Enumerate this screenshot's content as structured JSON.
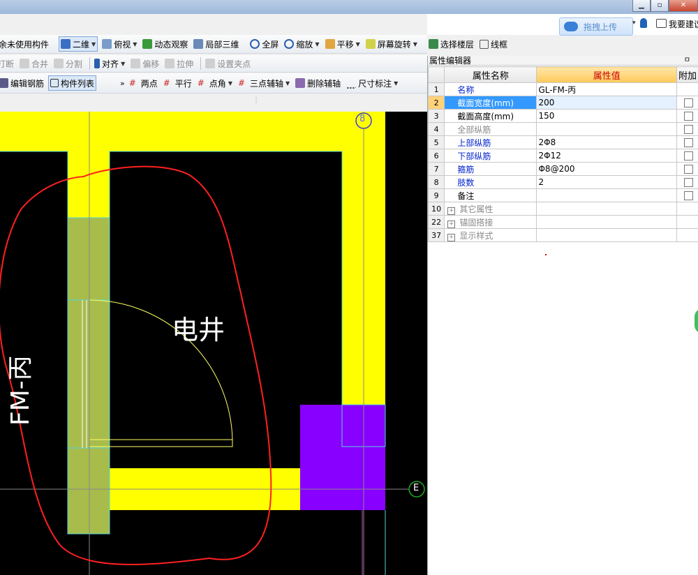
{
  "topbar": {
    "upload_label": "拖拽上传",
    "suggest_label": "我要建议",
    "min": "▁",
    "max": "▫",
    "close": "✕"
  },
  "toolbar1": {
    "items": [
      "余未使用构件",
      "二维",
      "俯视",
      "动态观察",
      "局部三维",
      "全屏",
      "缩放",
      "平移",
      "屏幕旋转",
      "选择楼层",
      "线框"
    ]
  },
  "toolbar2": {
    "items": [
      "打断",
      "合并",
      "分割",
      "对齐",
      "偏移",
      "拉伸",
      "设置夹点"
    ]
  },
  "toolbar3": {
    "items": [
      "编辑钢筋",
      "构件列表",
      "两点",
      "平行",
      "点角",
      "三点辅轴",
      "删除辅轴",
      "尺寸标注"
    ]
  },
  "canvas": {
    "axis_8": "8",
    "axis_e": "E",
    "room_label": "电井",
    "component_label": "FM-丙"
  },
  "properties": {
    "panel_title": "属性编辑器",
    "pin": "ㅁ",
    "col_name": "属性名称",
    "col_value": "属性值",
    "col_add": "附加",
    "rows": [
      {
        "num": "1",
        "name": "名称",
        "value": "GL-FM-丙"
      },
      {
        "num": "2",
        "name": "截面宽度(mm)",
        "value": "200"
      },
      {
        "num": "3",
        "name": "截面高度(mm)",
        "value": "150"
      },
      {
        "num": "4",
        "name": "全部纵筋",
        "value": ""
      },
      {
        "num": "5",
        "name": "上部纵筋",
        "value": "2Φ8"
      },
      {
        "num": "6",
        "name": "下部纵筋",
        "value": "2Φ12"
      },
      {
        "num": "7",
        "name": "箍筋",
        "value": "Φ8@200"
      },
      {
        "num": "8",
        "name": "肢数",
        "value": "2"
      },
      {
        "num": "9",
        "name": "备注",
        "value": ""
      },
      {
        "num": "10",
        "name": "其它属性",
        "value": ""
      },
      {
        "num": "22",
        "name": "锚固搭接",
        "value": ""
      },
      {
        "num": "37",
        "name": "显示样式",
        "value": ""
      }
    ]
  }
}
